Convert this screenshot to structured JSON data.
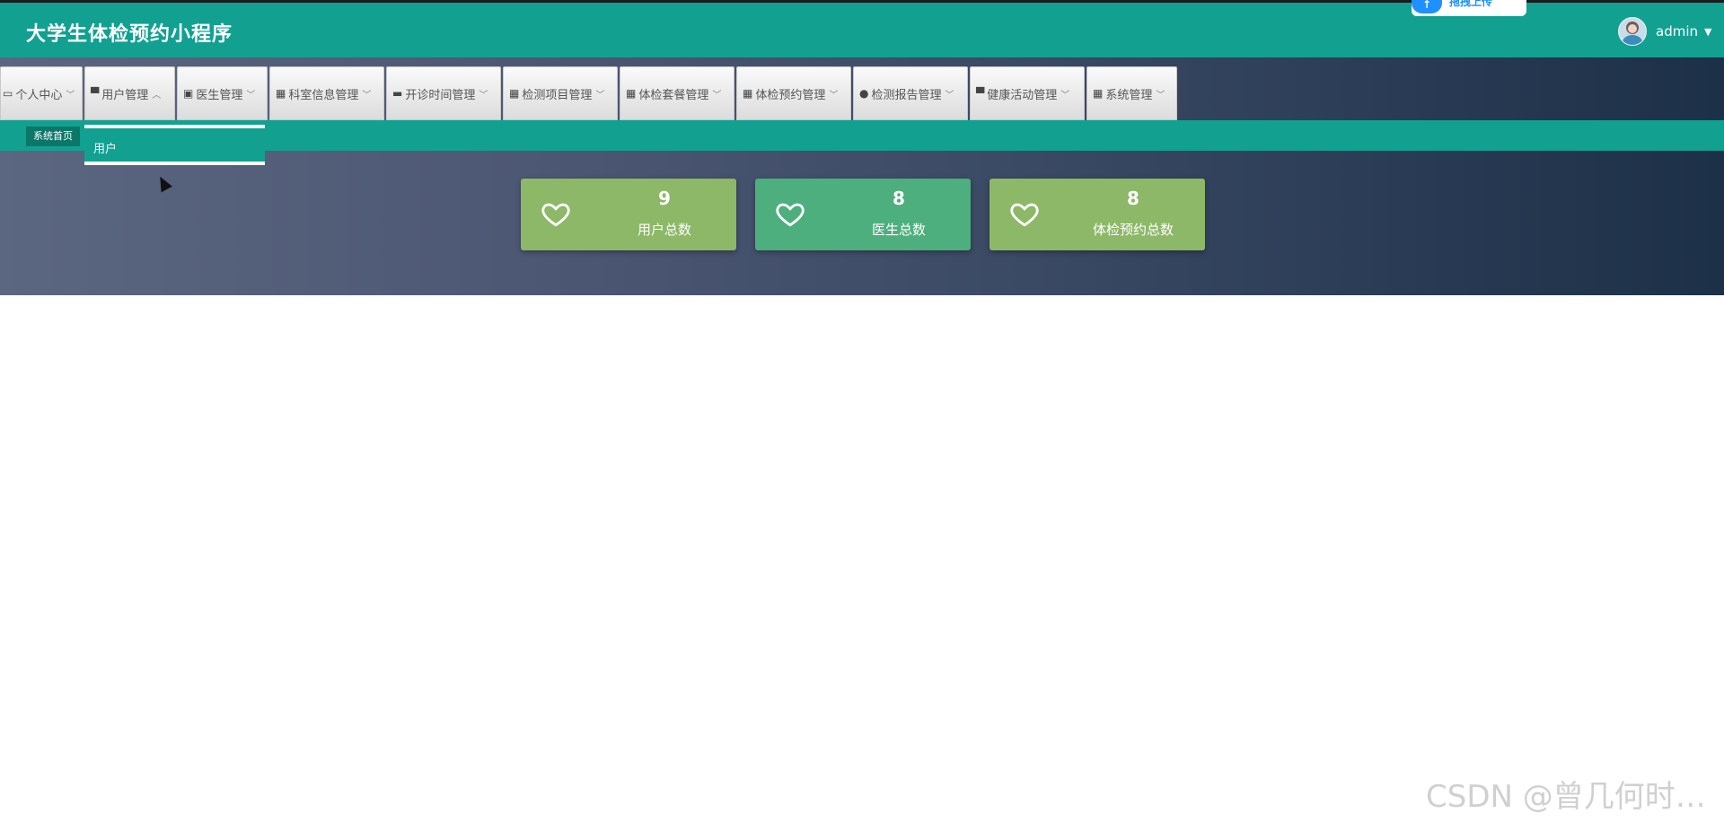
{
  "app": {
    "title": "大学生体检预约小程序"
  },
  "header": {
    "user_name": "admin",
    "upload_badge_text": "拖拽上传",
    "upload_badge_icon": "upload-icon"
  },
  "nav": {
    "items": [
      {
        "label": "个人中心",
        "icon": "card-icon"
      },
      {
        "label": "用户管理",
        "icon": "user-icon"
      },
      {
        "label": "医生管理",
        "icon": "clipboard-icon"
      },
      {
        "label": "科室信息管理",
        "icon": "grid-icon"
      },
      {
        "label": "开诊时间管理",
        "icon": "chat-icon"
      },
      {
        "label": "检测项目管理",
        "icon": "grid-icon"
      },
      {
        "label": "体检套餐管理",
        "icon": "grid-icon"
      },
      {
        "label": "体检预约管理",
        "icon": "grid-icon"
      },
      {
        "label": "检测报告管理",
        "icon": "user-icon"
      },
      {
        "label": "健康活动管理",
        "icon": "book-icon"
      },
      {
        "label": "系统管理",
        "icon": "grid-icon"
      }
    ]
  },
  "breadcrumb": {
    "label": "系统首页"
  },
  "dropdown": {
    "items": [
      "用户"
    ]
  },
  "cards": [
    {
      "value": "9",
      "label": "用户总数",
      "color": "#8cb868"
    },
    {
      "value": "8",
      "label": "医生总数",
      "color": "#4caf7d"
    },
    {
      "value": "8",
      "label": "体检预约总数",
      "color": "#8cb868"
    }
  ],
  "watermark": "CSDN @曾几何时…"
}
